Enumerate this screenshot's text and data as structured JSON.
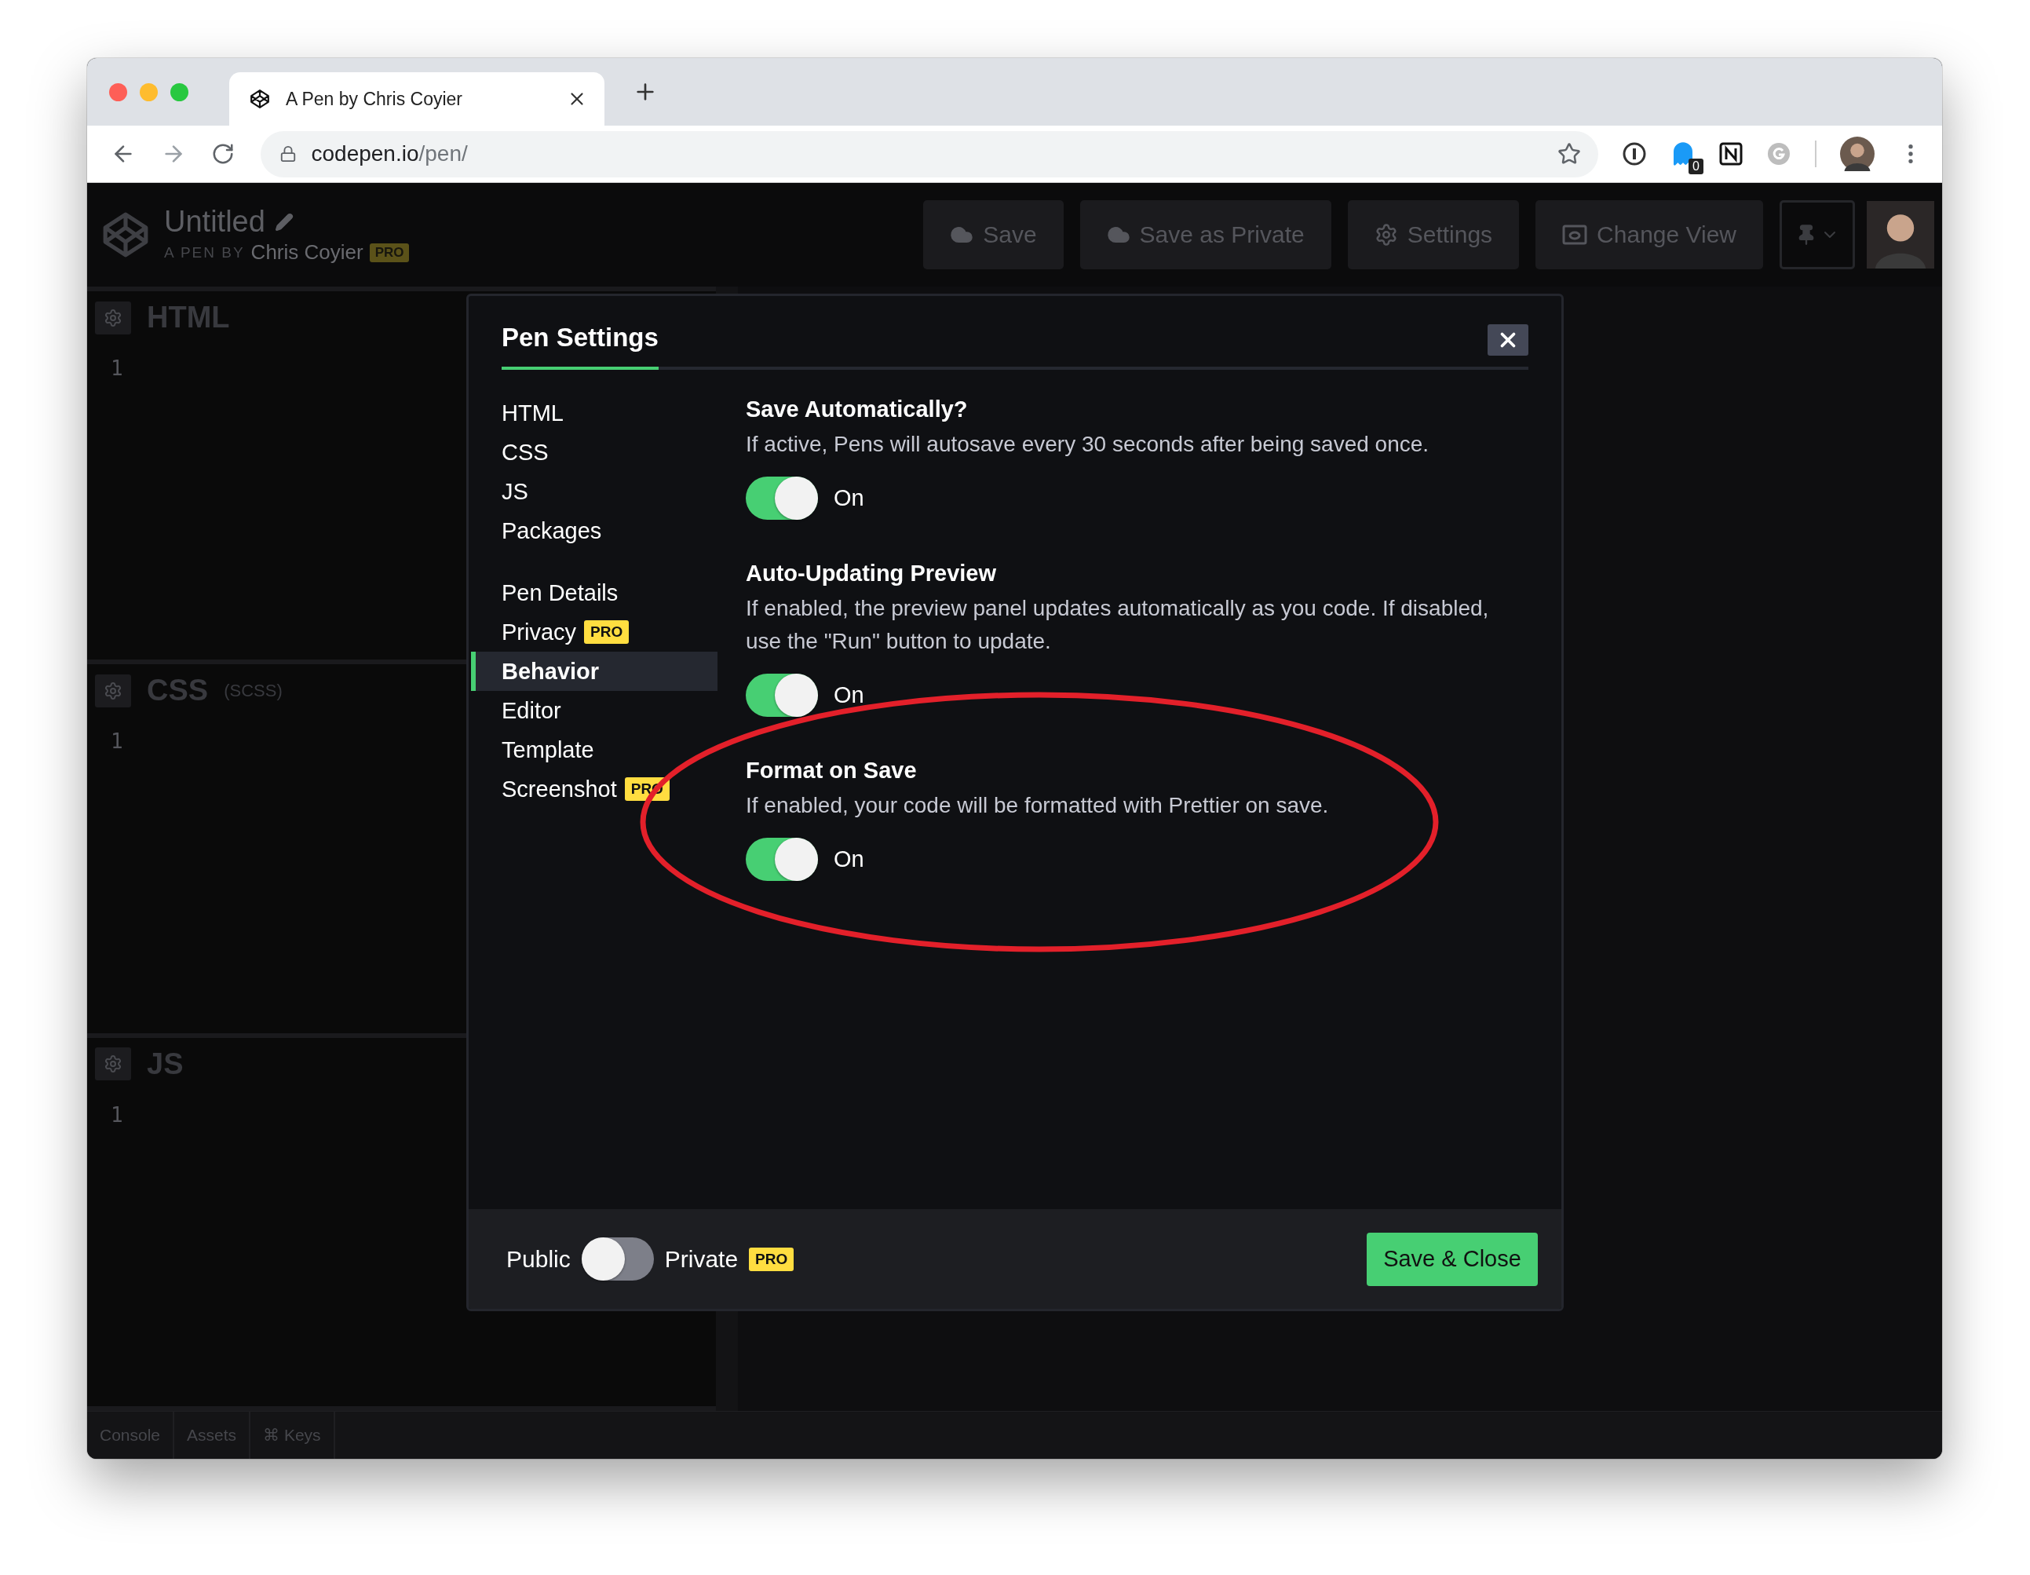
{
  "browser": {
    "tab_title": "A Pen by Chris Coyier",
    "url_host": "codepen.io",
    "url_path": "/pen/",
    "extension_badge": "0"
  },
  "header": {
    "title": "Untitled",
    "byline": "A PEN BY",
    "author": "Chris Coyier",
    "author_badge": "PRO",
    "buttons": [
      {
        "label": "Save"
      },
      {
        "label": "Save as Private"
      },
      {
        "label": "Settings"
      },
      {
        "label": "Change View"
      }
    ]
  },
  "editors": [
    {
      "title": "HTML",
      "line": "1"
    },
    {
      "title": "CSS",
      "preprocessor": "(SCSS)",
      "line": "1"
    },
    {
      "title": "JS",
      "line": "1"
    }
  ],
  "bottom_bar": [
    "Console",
    "Assets",
    "⌘ Keys"
  ],
  "modal": {
    "title": "Pen Settings",
    "nav_groups": [
      [
        {
          "label": "HTML",
          "selected": false
        },
        {
          "label": "CSS",
          "selected": false
        },
        {
          "label": "JS",
          "selected": false
        },
        {
          "label": "Packages",
          "selected": false
        }
      ],
      [
        {
          "label": "Pen Details",
          "selected": false
        },
        {
          "label": "Privacy",
          "badge": "PRO",
          "selected": false
        },
        {
          "label": "Behavior",
          "selected": true
        },
        {
          "label": "Editor",
          "selected": false
        },
        {
          "label": "Template",
          "selected": false
        },
        {
          "label": "Screenshot",
          "badge": "PRO",
          "selected": false
        }
      ]
    ],
    "settings": [
      {
        "title": "Save Automatically?",
        "description": "If active, Pens will autosave every 30 seconds after being saved once.",
        "on": true,
        "state_label": "On"
      },
      {
        "title": "Auto-Updating Preview",
        "description": "If enabled, the preview panel updates automatically as you code. If disabled, use the \"Run\" button to update.",
        "on": true,
        "state_label": "On"
      },
      {
        "title": "Format on Save",
        "description": "If enabled, your code will be formatted with Prettier on save.",
        "on": true,
        "state_label": "On"
      }
    ],
    "footer": {
      "public_label": "Public",
      "private_on": false,
      "private_label": "Private",
      "private_badge": "PRO",
      "save_button": "Save & Close"
    }
  }
}
